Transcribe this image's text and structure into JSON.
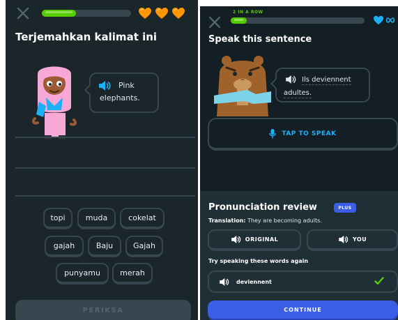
{
  "left": {
    "progress_value": 0.38,
    "hearts_count": 3,
    "title": "Terjemahkan kalimat ini",
    "bubble_lines": [
      "Pink",
      "elephants."
    ],
    "word_bank": [
      "topi",
      "muda",
      "cokelat",
      "gajah",
      "Baju",
      "Gajah",
      "punyamu",
      "merah"
    ],
    "check_label": "PERIKSA"
  },
  "right": {
    "streak_label": "2 IN A ROW",
    "progress_value": 0.12,
    "title": "Speak this sentence",
    "sentence_line1": "Ils deviennent",
    "sentence_line2": "adultes.",
    "tap_label": "TAP TO SPEAK",
    "review": {
      "title": "Pronunciation review",
      "badge": "PLUS",
      "translation_label": "Translation:",
      "translation_text": " They are becoming adults.",
      "original_label": "ORIGINAL",
      "you_label": "YOU",
      "try_label": "Try speaking these words again",
      "word": "deviennent",
      "continue_label": "CONTINUE"
    }
  },
  "colors": {
    "green": "#58cc02",
    "heart": "#ff9600",
    "blue": "#1cb0f6",
    "brand_blue": "#3b5ee6",
    "border": "#37464f"
  },
  "icons": [
    "close-icon",
    "heart-icon",
    "speaker-icon",
    "microphone-icon",
    "check-icon"
  ]
}
